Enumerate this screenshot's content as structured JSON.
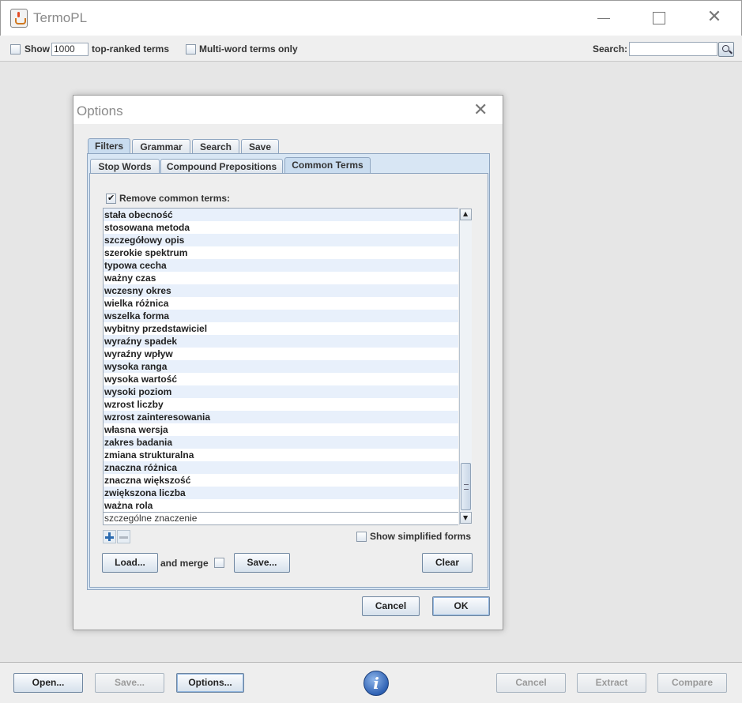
{
  "app": {
    "title": "TermoPL",
    "minimize_glyph": "",
    "close_glyph": "✕"
  },
  "toolbar": {
    "show_label": "Show",
    "show_count": "1000",
    "top_ranked_label": "top-ranked terms",
    "multiword_label": "Multi-word terms only",
    "search_label": "Search:",
    "search_value": ""
  },
  "dialog": {
    "title": "Options",
    "close_glyph": "✕",
    "main_tabs": [
      "Filters",
      "Grammar",
      "Search",
      "Save"
    ],
    "sub_tabs": [
      "Stop Words",
      "Compound Prepositions",
      "Common Terms"
    ],
    "remove_common_label": "Remove common terms:",
    "remove_common_checked": true,
    "terms": [
      "stała obecność",
      "stosowana metoda",
      "szczegółowy opis",
      "szerokie spektrum",
      "typowa cecha",
      "ważny czas",
      "wczesny okres",
      "wielka różnica",
      "wszelka forma",
      "wybitny przedstawiciel",
      "wyraźny spadek",
      "wyraźny wpływ",
      "wysoka ranga",
      "wysoka wartość",
      "wysoki poziom",
      "wzrost liczby",
      "wzrost zainteresowania",
      "własna wersja",
      "zakres badania",
      "zmiana strukturalna",
      "znaczna różnica",
      "znaczna większość",
      "zwiększona liczba",
      "ważna rola"
    ],
    "edit_value": "szczególne znaczenie",
    "show_simplified_label": "Show simplified forms",
    "load_label": "Load...",
    "and_merge_label": "and merge",
    "save_label": "Save...",
    "clear_label": "Clear",
    "cancel_label": "Cancel",
    "ok_label": "OK"
  },
  "bottom": {
    "open_label": "Open...",
    "save_label": "Save...",
    "options_label": "Options...",
    "info_glyph": "i",
    "cancel_label": "Cancel",
    "extract_label": "Extract",
    "compare_label": "Compare"
  },
  "colors": {
    "accent": "#2f62b4",
    "tab_active": "#c9dcef",
    "list_stripe": "#e8f0fb"
  },
  "icons": [
    "java-app-icon",
    "search-icon",
    "plus-icon",
    "minus-icon",
    "info-icon",
    "close-icon"
  ]
}
